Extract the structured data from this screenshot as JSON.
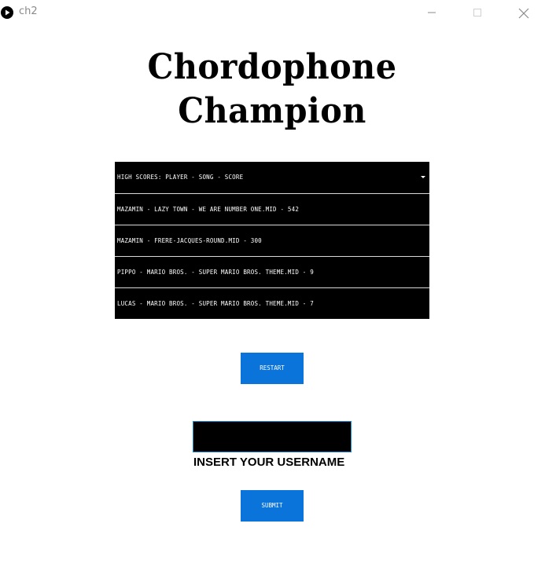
{
  "window": {
    "title": "ch2",
    "icon": "play-circle-icon",
    "controls": [
      "minimize-icon",
      "maximize-icon",
      "close-icon"
    ]
  },
  "logo": {
    "line1": "Chordophone",
    "line2": "Champion"
  },
  "high_scores": {
    "header": "HIGH SCORES: PLAYER - SONG - SCORE",
    "entries": [
      "MAZAMIN - LAZY TOWN - WE ARE NUMBER ONE.MID - 542",
      "MAZAMIN - FRERE-JACQUES-ROUND.MID - 300",
      "PIPPO - MARIO BROS. - SUPER MARIO BROS. THEME.MID - 9",
      "LUCAS - MARIO BROS. - SUPER MARIO BROS. THEME.MID - 7"
    ]
  },
  "buttons": {
    "restart": "RESTART",
    "submit": "SUBMIT"
  },
  "username": {
    "value": "",
    "label": "INSERT YOUR USERNAME"
  },
  "colors": {
    "accent": "#0a74da",
    "list_background": "#000000",
    "input_border": "#1e90d6"
  }
}
